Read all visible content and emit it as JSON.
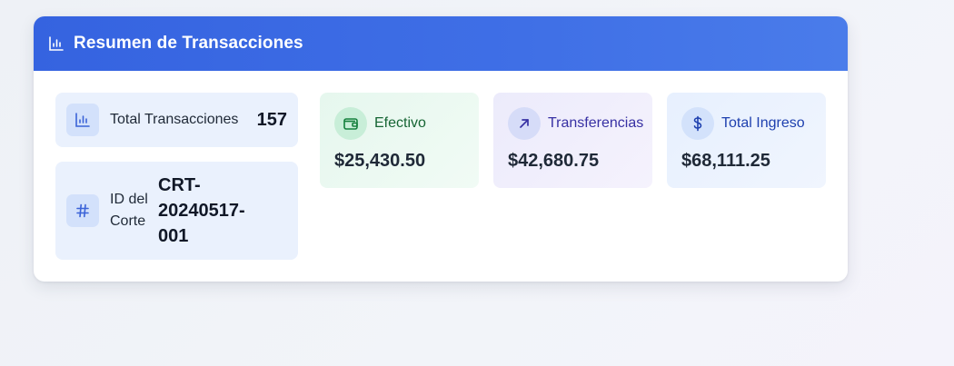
{
  "header": {
    "icon": "bar-chart-icon",
    "title": "Resumen de Transacciones"
  },
  "summary": {
    "total": {
      "icon": "bar-chart-icon",
      "label": "Total Transacciones",
      "value": "157"
    },
    "cut_id": {
      "icon": "hash-icon",
      "label": "ID del Corte",
      "value": "CRT-20240517-001"
    }
  },
  "stats": [
    {
      "icon": "wallet-icon",
      "label": "Efectivo",
      "value": "$25,430.50",
      "accent": "#166534",
      "bg": "#e6f7ee"
    },
    {
      "icon": "arrow-up-right-icon",
      "label": "Transferencias",
      "value": "$42,680.75",
      "accent": "#3730a3",
      "bg": "#ecebfb"
    },
    {
      "icon": "dollar-icon",
      "label": "Total Ingreso",
      "value": "$68,111.25",
      "accent": "#1e40af",
      "bg": "#e7f0fe"
    }
  ],
  "colors": {
    "header_gradient_start": "#3563e0",
    "header_gradient_end": "#4a7cea"
  }
}
